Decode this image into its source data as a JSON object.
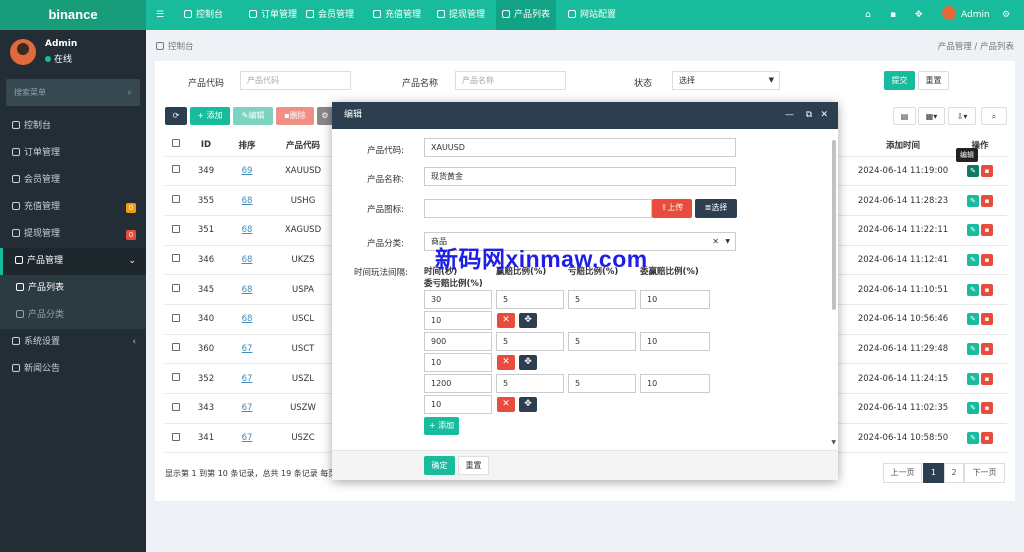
{
  "brand": "binance",
  "topnav": {
    "items": [
      "控制台",
      "订单管理",
      "会员管理",
      "充值管理",
      "提现管理",
      "产品列表",
      "网站配置"
    ],
    "active_index": 5,
    "user": "Admin"
  },
  "sidebar": {
    "user_name": "Admin",
    "status": "在线",
    "search_placeholder": "搜索菜单",
    "items": [
      {
        "label": "控制台"
      },
      {
        "label": "订单管理"
      },
      {
        "label": "会员管理"
      },
      {
        "label": "充值管理",
        "badge": "0",
        "badge_color": "#f39c12"
      },
      {
        "label": "提现管理",
        "badge": "0",
        "badge_color": "#e74c3c"
      },
      {
        "label": "产品管理"
      },
      {
        "label": "产品列表"
      },
      {
        "label": "产品分类"
      },
      {
        "label": "系统设置"
      },
      {
        "label": "新闻公告"
      }
    ]
  },
  "breadcrumb": {
    "left": "控制台",
    "right": "产品管理 / 产品列表"
  },
  "filter": {
    "code_label": "产品代码",
    "code_placeholder": "产品代码",
    "name_label": "产品名称",
    "name_placeholder": "产品名称",
    "status_label": "状态",
    "status_value": "选择",
    "submit": "提交",
    "reset": "重置"
  },
  "toolbar": {
    "add": "添加",
    "edit": "编辑",
    "delete": "删除"
  },
  "table": {
    "headers": [
      "ID",
      "排序",
      "产品代码",
      "添加时间",
      "操作"
    ],
    "rows": [
      {
        "id": "349",
        "sort": "69",
        "code": "XAUUSD",
        "time": "2024-06-14 11:19:00"
      },
      {
        "id": "355",
        "sort": "68",
        "code": "USHG",
        "time": "2024-06-14 11:28:23"
      },
      {
        "id": "351",
        "sort": "68",
        "code": "XAGUSD",
        "time": "2024-06-14 11:22:11"
      },
      {
        "id": "346",
        "sort": "68",
        "code": "UKZS",
        "time": "2024-06-14 11:12:41"
      },
      {
        "id": "345",
        "sort": "68",
        "code": "USPA",
        "time": "2024-06-14 11:10:51"
      },
      {
        "id": "340",
        "sort": "68",
        "code": "USCL",
        "time": "2024-06-14 10:56:46"
      },
      {
        "id": "360",
        "sort": "67",
        "code": "USCT",
        "time": "2024-06-14 11:29:48"
      },
      {
        "id": "352",
        "sort": "67",
        "code": "USZL",
        "time": "2024-06-14 11:24:15"
      },
      {
        "id": "343",
        "sort": "67",
        "code": "USZW",
        "time": "2024-06-14 11:02:35"
      },
      {
        "id": "341",
        "sort": "67",
        "code": "USZC",
        "time": "2024-06-14 10:58:50"
      }
    ],
    "tooltip": "编辑"
  },
  "footer": {
    "summary": "显示第 1 到第 10 条记录，总共 19 条记录 每页",
    "prev": "上一页",
    "pages": [
      "1",
      "2"
    ],
    "next": "下一页"
  },
  "dialog": {
    "title": "编辑",
    "code_label": "产品代码:",
    "code_value": "XAUUSD",
    "name_label": "产品名称:",
    "name_value": "现货黄金",
    "icon_label": "产品图标:",
    "upload": "上传",
    "choose": "选择",
    "category_label": "产品分类:",
    "category_value": "商品",
    "interval_label": "时间玩法间隔:",
    "col_headers": [
      "时间(秒)",
      "赢赔比例(%)",
      "亏赔比例(%)",
      "委赢赔比例(%)",
      "委亏赔比例(%)"
    ],
    "rows": [
      {
        "time": "30",
        "win": "5",
        "loss": "5",
        "entrust_win": "10",
        "entrust_loss": "10"
      },
      {
        "time": "900",
        "win": "5",
        "loss": "5",
        "entrust_win": "10",
        "entrust_loss": "10"
      },
      {
        "time": "1200",
        "win": "5",
        "loss": "5",
        "entrust_win": "10",
        "entrust_loss": "10"
      }
    ],
    "add": "添加",
    "confirm": "确定",
    "reset": "重置"
  },
  "watermark": "新码网xinmaw.com",
  "colors": {
    "primary": "#18bc9c",
    "dark": "#2c3e50",
    "danger": "#e74c3c",
    "sidebar": "#232d36"
  }
}
